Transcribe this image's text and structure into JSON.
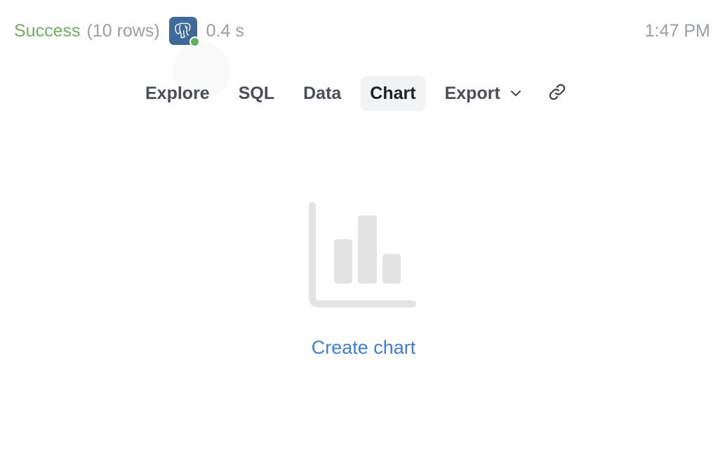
{
  "status": {
    "result": "Success",
    "rows": "(10 rows)",
    "database_icon": "postgres-elephant-icon",
    "connection_status_color": "#5fb157",
    "duration": "0.4 s",
    "time": "1:47 PM"
  },
  "tabs": [
    {
      "label": "Explore",
      "active": false
    },
    {
      "label": "SQL",
      "active": false
    },
    {
      "label": "Data",
      "active": false
    },
    {
      "label": "Chart",
      "active": true
    },
    {
      "label": "Export",
      "active": false,
      "dropdown": true
    }
  ],
  "link_icon": "link-icon",
  "empty_state": {
    "icon": "bar-chart-icon",
    "action_label": "Create chart"
  },
  "colors": {
    "success": "#6db25f",
    "link": "#3f7fd8",
    "active_tab_bg": "#f2f3f5",
    "db_icon_bg": "#3e6a99"
  }
}
